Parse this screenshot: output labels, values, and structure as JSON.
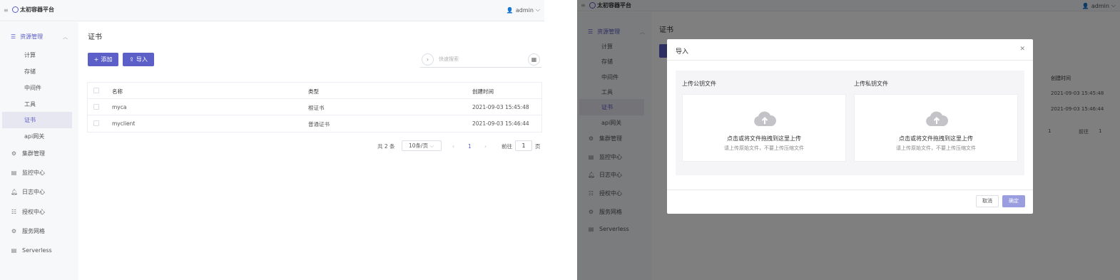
{
  "app": {
    "title": "太初容器平台",
    "user": "admin"
  },
  "sidebar": {
    "group_label": "资源管理",
    "sub_items": [
      {
        "label": "计算"
      },
      {
        "label": "存储"
      },
      {
        "label": "中间件"
      },
      {
        "label": "工具"
      },
      {
        "label": "证书"
      },
      {
        "label": "api网关"
      }
    ],
    "nav_items": [
      {
        "label": "集群管理",
        "icon": "cluster-icon"
      },
      {
        "label": "监控中心",
        "icon": "monitor-icon"
      },
      {
        "label": "日志中心",
        "icon": "bell-icon"
      },
      {
        "label": "授权中心",
        "icon": "auth-icon"
      },
      {
        "label": "服务网格",
        "icon": "mesh-icon"
      },
      {
        "label": "Serverless",
        "icon": "serverless-icon"
      }
    ]
  },
  "page": {
    "title": "证书"
  },
  "toolbar": {
    "add_label": "添加",
    "import_label": "导入",
    "search_placeholder": "快速搜索"
  },
  "table": {
    "headers": {
      "name": "名称",
      "type": "类型",
      "created": "创建时间"
    },
    "rows": [
      {
        "name": "myca",
        "type": "根证书",
        "created": "2021-09-03 15:45:48"
      },
      {
        "name": "myclient",
        "type": "普通证书",
        "created": "2021-09-03 15:46:44"
      }
    ]
  },
  "pagination": {
    "total": "共 2 条",
    "page_size": "10条/页",
    "current": "1",
    "goto_label": "前往",
    "goto_value": "1",
    "page_suffix": "页"
  },
  "modal": {
    "title": "导入",
    "public_label": "上传公钥文件",
    "private_label": "上传私钥文件",
    "upload_text": "点击或将文件拖拽到这里上传",
    "upload_hint": "请上传原始文件，不要上传压缩文件",
    "cancel": "取消",
    "confirm": "确定"
  },
  "colors": {
    "accent": "#5b5fc7",
    "sidebar_bg": "#f7f8fa",
    "active_bg": "#e6e7f0"
  }
}
